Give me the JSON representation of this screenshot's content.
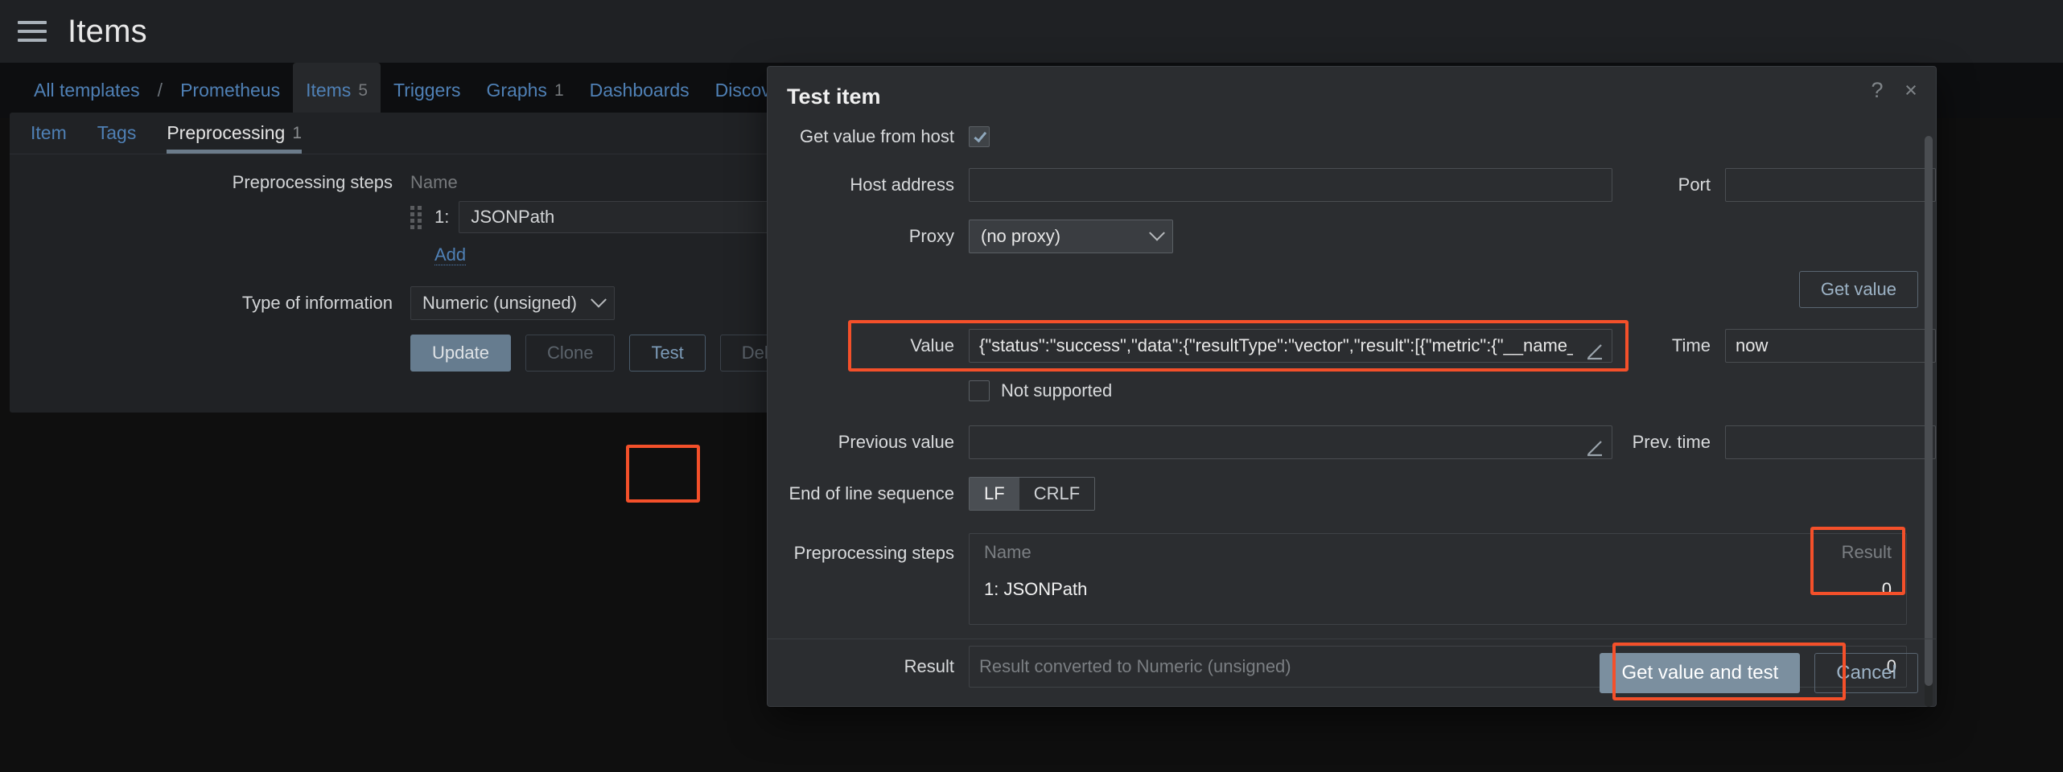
{
  "header": {
    "menu_icon": "hamburger-icon",
    "title": "Items"
  },
  "breadcrumb": {
    "items": [
      {
        "label": "All templates",
        "count": "",
        "active": false
      },
      {
        "label": "Prometheus",
        "count": "",
        "active": false
      },
      {
        "label": "Items",
        "count": "5",
        "active": true
      },
      {
        "label": "Triggers",
        "count": "",
        "active": false
      },
      {
        "label": "Graphs",
        "count": "1",
        "active": false
      },
      {
        "label": "Dashboards",
        "count": "",
        "active": false
      },
      {
        "label": "Discovery rules",
        "count": "",
        "active": false
      }
    ],
    "separator": "/"
  },
  "subtabs": [
    {
      "label": "Item",
      "count": "",
      "active": false
    },
    {
      "label": "Tags",
      "count": "",
      "active": false
    },
    {
      "label": "Preprocessing",
      "count": "1",
      "active": true
    }
  ],
  "item_form": {
    "preprocessing_label": "Preprocessing steps",
    "name_column_header": "Name",
    "step": {
      "number": "1:",
      "name": "JSONPath"
    },
    "add_label": "Add",
    "type_of_information_label": "Type of information",
    "type_of_information_value": "Numeric (unsigned)",
    "buttons": {
      "update": "Update",
      "clone": "Clone",
      "test": "Test",
      "delete": "Delete"
    }
  },
  "modal": {
    "title": "Test item",
    "help_icon": "?",
    "close_icon": "×",
    "get_value_from_host": {
      "label": "Get value from host",
      "checked": true
    },
    "host_address": {
      "label": "Host address",
      "value": ""
    },
    "port": {
      "label": "Port",
      "value": ""
    },
    "proxy": {
      "label": "Proxy",
      "value": "(no proxy)"
    },
    "get_value_button": "Get value",
    "value": {
      "label": "Value",
      "text": "{\"status\":\"success\",\"data\":{\"resultType\":\"vector\",\"result\":[{\"metric\":{\"__name_…",
      "edit_icon": "pencil-icon"
    },
    "time": {
      "label": "Time",
      "value": "now"
    },
    "not_supported": {
      "label": "Not supported",
      "checked": false
    },
    "previous_value": {
      "label": "Previous value",
      "value": "",
      "edit_icon": "pencil-icon"
    },
    "prev_time": {
      "label": "Prev. time",
      "value": ""
    },
    "end_of_line_sequence": {
      "label": "End of line sequence",
      "options": [
        "LF",
        "CRLF"
      ],
      "selected": "LF"
    },
    "preprocessing": {
      "label": "Preprocessing steps",
      "columns": {
        "name": "Name",
        "result": "Result"
      },
      "rows": [
        {
          "name": "1: JSONPath",
          "result": "0"
        }
      ]
    },
    "result": {
      "label": "Result",
      "placeholder": "Result converted to Numeric (unsigned)",
      "value": "0"
    },
    "footer": {
      "primary": "Get value and test",
      "cancel": "Cancel"
    }
  },
  "highlights": {
    "color": "#f4502a",
    "regions": [
      "test-button",
      "value-field",
      "result-column",
      "get-value-and-test-button"
    ]
  }
}
